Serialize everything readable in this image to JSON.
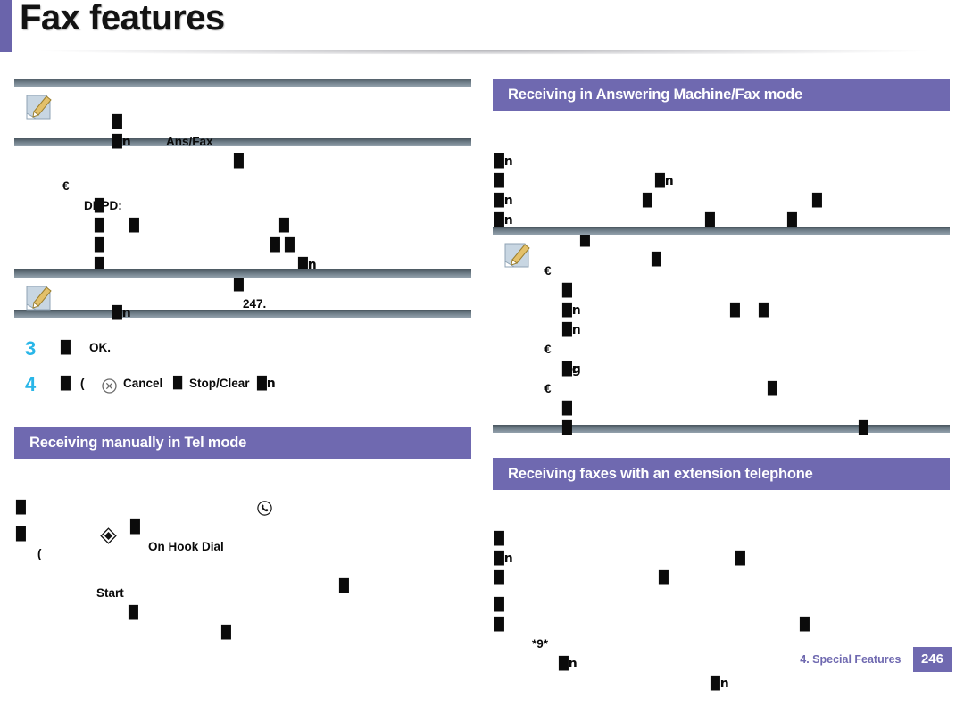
{
  "page": {
    "title": "Fax features",
    "accent_color": "#6a64ab",
    "heading_color": "#6f69b0",
    "step_number_color": "#29b6e8"
  },
  "footer": {
    "chapter_label": "4.  Special Features",
    "page_number": "246"
  },
  "left_column": {
    "note_top": {
      "icon": "note-pencil-icon",
      "lines": [
        {
          "keyword": "Ans/Fax",
          "blobs": [
            "█",
            "█"
          ]
        },
        {
          "keyword": "",
          "blobs": [
            "█n"
          ]
        }
      ]
    },
    "drpd_block": {
      "bullet": "€",
      "keyword": "DRPD:",
      "lines": [
        {
          "blobs": [
            "█",
            "█"
          ]
        },
        {
          "blobs": [
            "█",
            "█"
          ]
        },
        {
          "blobs": [
            "█",
            "█"
          ]
        },
        {
          "blobs": [
            "█",
            "█n"
          ]
        },
        {
          "blobs": [
            "█",
            "█"
          ],
          "reference": "247."
        }
      ]
    },
    "note_bottom": {
      "icon": "note-pencil-icon",
      "lines": [
        {
          "blobs": [
            "█n"
          ]
        }
      ]
    },
    "steps": [
      {
        "number": "3",
        "text": "OK.",
        "icons": []
      },
      {
        "number": "4",
        "text": "Cancel",
        "text2": "Stop/Clear",
        "icons": [
          "circle-x-icon"
        ]
      }
    ],
    "section_heading": "Receiving manually in Tel mode",
    "tel_mode_lines": [
      {
        "keyword": "On Hook Dial",
        "icon": "phone-icon",
        "blobs": [
          "█",
          "█",
          "█"
        ]
      },
      {
        "keyword": "Start",
        "icon": "diamond-icon",
        "blobs": [
          "█",
          "█",
          "█"
        ]
      }
    ]
  },
  "right_column": {
    "section_heading_1": "Receiving in Answering Machine/Fax mode",
    "ans_fax_lines": [
      {
        "blobs": [
          "█n",
          "█n",
          "█"
        ]
      },
      {
        "blobs": [
          "█",
          "█",
          "█"
        ]
      },
      {
        "blobs": [
          "█n",
          "█"
        ]
      },
      {
        "blobs": [
          "█n",
          "█",
          "█"
        ]
      }
    ],
    "note_box": {
      "icon": "note-pencil-icon",
      "items": [
        {
          "bullet": "€",
          "lines": [
            {
              "blobs": [
                "█",
                "█"
              ]
            },
            {
              "blobs": [
                "█",
                "█"
              ]
            },
            {
              "blobs": [
                "█n",
                "█n"
              ]
            },
            {
              "blobs": [
                "█n"
              ]
            }
          ]
        },
        {
          "bullet": "€",
          "lines": [
            {
              "blobs": [
                "█n",
                "█"
              ]
            },
            {
              "blobs": [
                "█g"
              ]
            }
          ]
        },
        {
          "bullet": "€",
          "lines": [
            {
              "blobs": [
                "█",
                "█"
              ]
            },
            {
              "blobs": [
                "█"
              ]
            },
            {
              "blobs": [
                "█"
              ]
            }
          ]
        }
      ]
    },
    "section_heading_2": "Receiving faxes with an extension telephone",
    "extension_lines": [
      {
        "blobs": [
          "█",
          "█"
        ]
      },
      {
        "blobs": [
          "█n",
          "█"
        ]
      },
      {
        "blobs": [
          "█"
        ]
      },
      {
        "blobs": [
          "█",
          "█"
        ]
      },
      {
        "blobs": [
          "█"
        ],
        "keyword": "*9*",
        "trailing": "█n"
      }
    ]
  }
}
